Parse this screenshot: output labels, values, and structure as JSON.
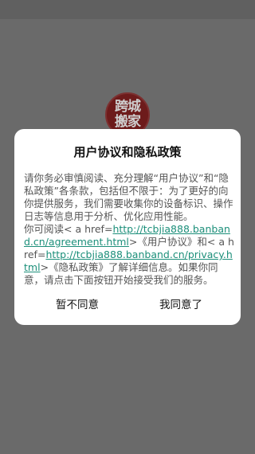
{
  "logo": {
    "line1": "跨城",
    "line2": "搬家"
  },
  "dialog": {
    "title": "用户协议和隐私政策",
    "paragraph1": "请你务必审慎阅读、充分理解“用户协议”和“隐私政策”各条款，包括但不限于：为了更好的向你提供服务，我们需要收集你的设备标识、操作日志等信息用于分析、优化应用性能。",
    "p2_prefix": "你可阅读< a href=",
    "agreement_url": "http://tcbjia888.banband.cn/agreement.html",
    "p2_mid": ">《用户协议》和< a href=",
    "privacy_url": "http://tcbjia888.banband.cn/privacy.html",
    "p2_suffix": ">《隐私政策》了解详细信息。如果你同意，请点击下面按钮开始接受我们的服务。",
    "disagree_label": "暂不同意",
    "agree_label": "我同意了"
  }
}
